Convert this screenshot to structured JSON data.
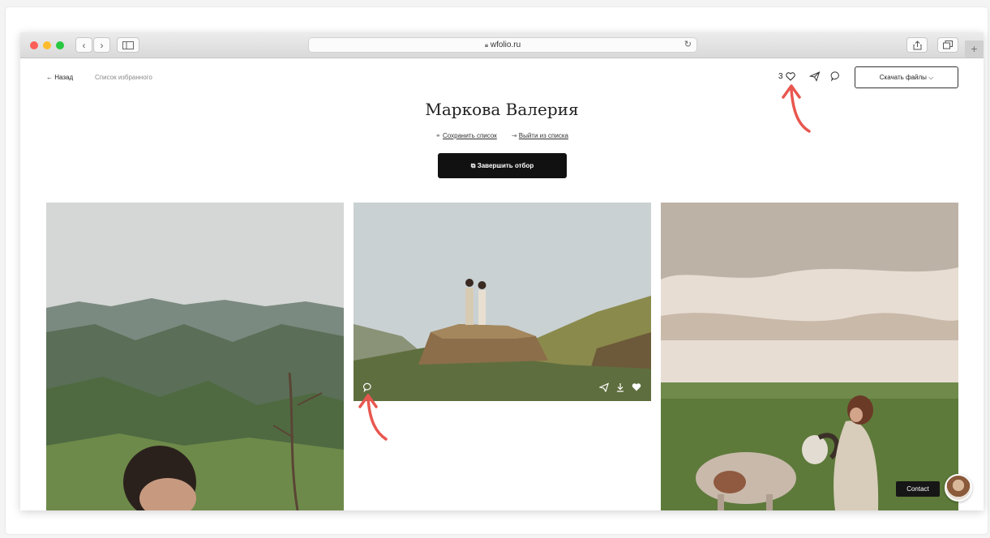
{
  "browser": {
    "url": "wfolio.ru"
  },
  "nav": {
    "back_label": "← Назад",
    "breadcrumb": "Список избранного"
  },
  "header": {
    "favorites_count": "3",
    "download_label": "Скачать файлы ⌵"
  },
  "main": {
    "title": "Маркова Валерия",
    "save_list_label": "Сохранить список",
    "exit_list_label": "Выйти из списка",
    "finish_label": "Завершить отбор"
  },
  "widget": {
    "contact_label": "Contact"
  },
  "colors": {
    "annotation_arrow": "#e8574f",
    "button_dark": "#111111"
  },
  "icons": [
    "link-icon",
    "exit-icon",
    "external-link-icon",
    "heart-icon",
    "send-icon",
    "comment-icon",
    "download-icon",
    "lock-icon",
    "reload-icon",
    "share-icon",
    "tabs-icon",
    "sidebar-icon"
  ]
}
